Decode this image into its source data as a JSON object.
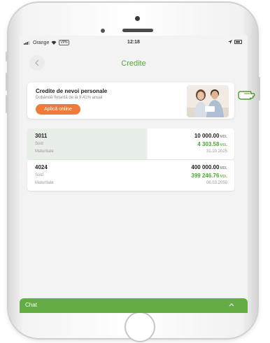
{
  "status_bar": {
    "carrier": "Orange",
    "vpn": "VPN",
    "time": "12:18"
  },
  "header": {
    "title": "Credite"
  },
  "promo": {
    "title": "Credite de nevoi personale",
    "subtitle": "Dobândă flotantă de la 9,41% anual",
    "button_label": "Aplică online"
  },
  "credits": [
    {
      "id": "3011",
      "amount": "10 000.00",
      "balance_label": "Sold",
      "balance": "4 303.58",
      "maturity_label": "Maturitate",
      "maturity": "31.10.2025",
      "currency": "MDL"
    },
    {
      "id": "4024",
      "amount": "400 000.00",
      "balance_label": "Sold",
      "balance": "399 246.76",
      "maturity_label": "Maturitate",
      "maturity": "06.03.2050",
      "currency": "MDL"
    }
  ],
  "chat": {
    "label": "Chat"
  },
  "colors": {
    "accent_green": "#5aa63f",
    "button_orange": "#f07a3a",
    "chat_green": "#64ad44"
  }
}
